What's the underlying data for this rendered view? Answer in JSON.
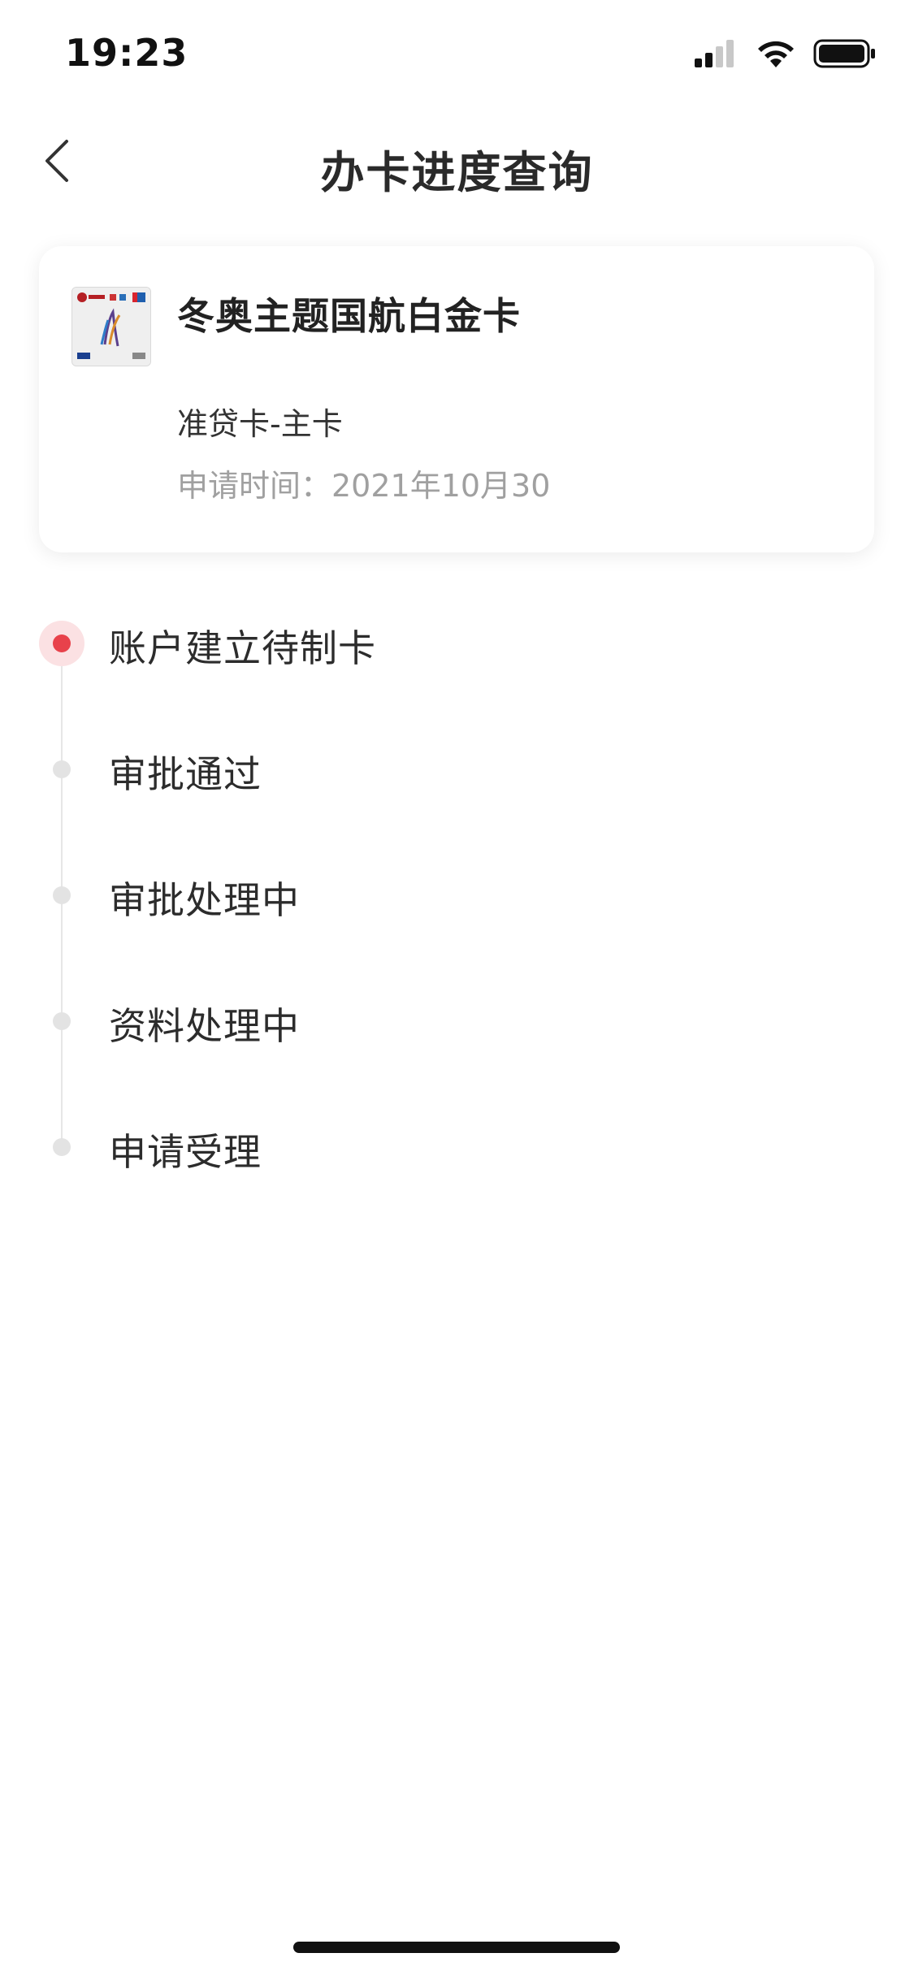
{
  "status_bar": {
    "time": "19:23",
    "icons": [
      "cellular-signal-icon",
      "wifi-icon",
      "battery-icon"
    ]
  },
  "nav": {
    "title": "办卡进度查询",
    "back_icon": "chevron-left-icon"
  },
  "card": {
    "name": "冬奥主题国航白金卡",
    "type": "准贷卡-主卡",
    "apply_time": "申请时间：2021年10月30"
  },
  "timeline": {
    "items": [
      {
        "label": "账户建立待制卡",
        "active": true
      },
      {
        "label": "审批通过",
        "active": false
      },
      {
        "label": "审批处理中",
        "active": false
      },
      {
        "label": "资料处理中",
        "active": false
      },
      {
        "label": "申请受理",
        "active": false
      }
    ]
  },
  "colors": {
    "accent": "#e8424b",
    "accent_light": "#fbe1e3",
    "inactive_dot": "#e3e3e3",
    "muted_text": "#a0a0a0"
  }
}
